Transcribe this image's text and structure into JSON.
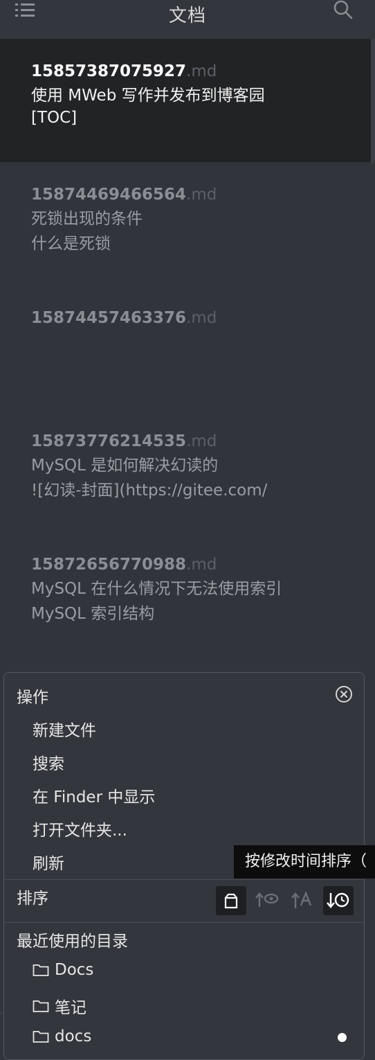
{
  "header": {
    "title": "文档",
    "menu_icon": "hamburger-menu-icon",
    "search_icon": "search-icon"
  },
  "documents": [
    {
      "number": "15857387075927",
      "ext": ".md",
      "lines": [
        "使用 MWeb 写作并发布到博客园",
        "[TOC]"
      ],
      "selected": true
    },
    {
      "number": "15874469466564",
      "ext": ".md",
      "lines": [
        "死锁出现的条件",
        "什么是死锁"
      ],
      "selected": false
    },
    {
      "number": "15874457463376",
      "ext": ".md",
      "lines": [],
      "selected": false
    },
    {
      "number": "15873776214535",
      "ext": ".md",
      "lines": [
        "MySQL 是如何解决幻读的",
        "![幻读-封面](https://gitee.com/"
      ],
      "selected": false
    },
    {
      "number": "15872656770988",
      "ext": ".md",
      "lines": [
        "MySQL 在什么情况下无法使用索引",
        "MySQL 索引结构"
      ],
      "selected": false
    }
  ],
  "panel": {
    "actions_title": "操作",
    "actions": [
      "新建文件",
      "搜索",
      "在 Finder 中显示",
      "打开文件夹...",
      "刷新"
    ],
    "sort_title": "排序",
    "sort_buttons": [
      "sort-by-none-icon",
      "sort-by-view-icon",
      "sort-by-name-icon",
      "sort-by-modified-time-icon"
    ],
    "recent_title": "最近使用的目录",
    "recent_folders": [
      "Docs",
      "笔记",
      "docs"
    ]
  },
  "tooltip": {
    "text": "按修改时间排序（"
  },
  "colors": {
    "background": "#31343b",
    "selected_row": "#222325",
    "panel": "#33363c",
    "tooltip": "#0d0d0e"
  }
}
